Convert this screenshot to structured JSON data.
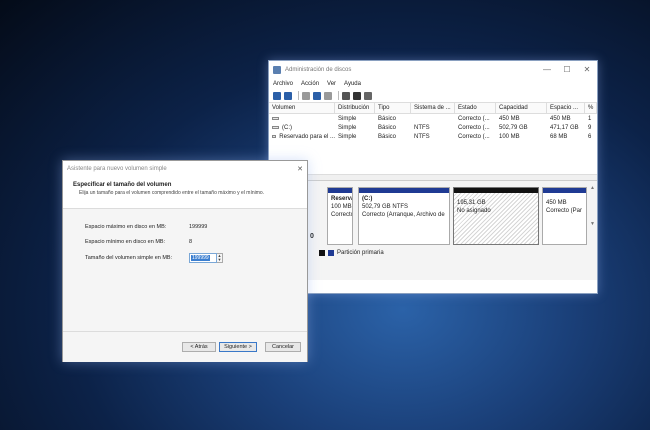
{
  "disk_management": {
    "title": "Administración de discos",
    "menu": [
      "Archivo",
      "Acción",
      "Ver",
      "Ayuda"
    ],
    "window_controls": [
      "—",
      "☐",
      "✕"
    ],
    "columns": [
      "Volumen",
      "Distribución",
      "Tipo",
      "Sistema de ...",
      "Estado",
      "Capacidad",
      "Espacio ...",
      "%"
    ],
    "rows": [
      {
        "volume": "",
        "layout": "Simple",
        "type": "Básico",
        "fs": "",
        "status": "Correcto (...",
        "capacity": "450 MB",
        "free": "450 MB",
        "pct": "1"
      },
      {
        "volume": "(C:)",
        "layout": "Simple",
        "type": "Básico",
        "fs": "NTFS",
        "status": "Correcto (...",
        "capacity": "502,79 GB",
        "free": "471,17 GB",
        "pct": "9"
      },
      {
        "volume": "Reservado para el ...",
        "layout": "Simple",
        "type": "Básico",
        "fs": "NTFS",
        "status": "Correcto (...",
        "capacity": "100 MB",
        "free": "68 MB",
        "pct": "6"
      }
    ],
    "partitions": {
      "reserved": {
        "name": "Reserva",
        "size": "100 MB N",
        "status": "Correcto"
      },
      "c_drive": {
        "name": "(C:)",
        "size": "502,79 GB NTFS",
        "status": "Correcto (Arranque, Archivo de"
      },
      "unallocated": {
        "size": "195,31 GB",
        "status": "No asignado"
      },
      "recovery": {
        "size": "450 MB",
        "status": "Correcto (Par"
      }
    },
    "disk_label": "0",
    "legend": {
      "primary_label": "Partición primaria",
      "primary_color": "#1f3a93",
      "unallocated_color": "#111111"
    }
  },
  "wizard": {
    "title": "Asistente para nuevo volumen simple",
    "close": "✕",
    "heading": "Especificar el tamaño del volumen",
    "subheading": "Elija un tamaño para el volumen comprendido entre el tamaño máximo y el mínimo.",
    "max_label": "Espacio máximo en disco en MB:",
    "max_value": "199999",
    "min_label": "Espacio mínimo en disco en MB:",
    "min_value": "8",
    "size_label": "Tamaño del volumen simple en MB:",
    "size_value": "199999",
    "back_label": "< Atrás",
    "next_label": "Siguiente >",
    "cancel_label": "Cancelar"
  }
}
